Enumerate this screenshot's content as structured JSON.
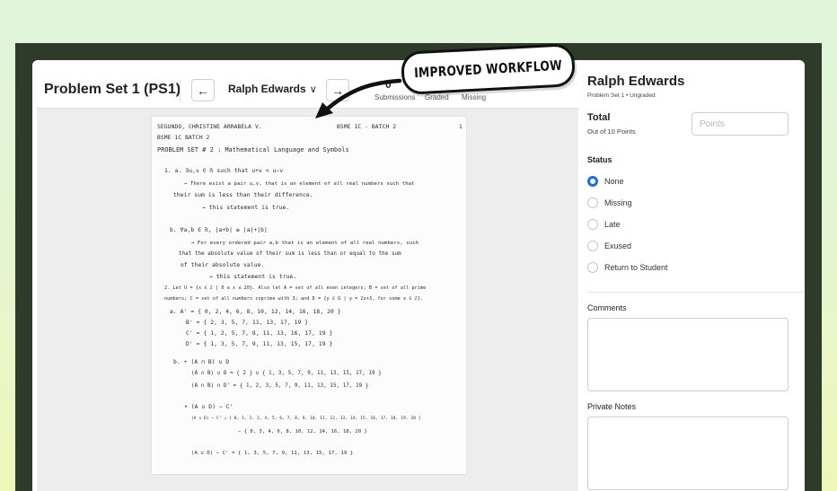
{
  "header": {
    "title": "Problem Set 1 (PS1)",
    "prev_icon": "arrow-left-icon",
    "next_icon": "arrow-right-icon",
    "student_name": "Ralph Edwards",
    "dropdown_icon": "chevron-down-icon",
    "stats": [
      {
        "value": "0",
        "label": "Submissions"
      },
      {
        "value": "",
        "label": "Graded"
      },
      {
        "value": "",
        "label": "Missing"
      }
    ]
  },
  "document": {
    "lines": [
      "SEGUNDO, CHRISTINE ARRABELA V.",
      "BSME 1C - BATCH 2",
      "1",
      "BSME 1C BATCH 2",
      "PROBLEM SET # 2 : Mathematical Language and Symbols",
      "1. a.  ∃u,v ∈ ℝ such that u+v < u−v",
      "→ There exist a pair u,v, that is an element of all real numbers such that",
      "their sum is less than their difference.",
      "→ this statement is true.",
      "b.  ∀a,b ∈ ℝ, |a+b| ≤ |a|+|b|",
      "→ For every ordered pair a,b that is an element of all real numbers, such",
      "that the absolute value of their sum is less than or equal to the sum",
      "of their absolute value.",
      "→ this statement is true.",
      "2. Let U = {x ∈ ℤ | 0 ≤ x ≤ 20}. Also let A = set of all even integers; B = set of all prime",
      "numbers; C = set of all numbers coprime with 3; and D = {y ∈ U | y = 2z+3, for some z ∈ ℤ}.",
      "a.   A' = { 0, 2, 4, 6, 8, 10, 12, 14, 16, 18, 20 }",
      "B' = { 2, 3, 5, 7, 11, 13, 17, 19 }",
      "C' = { 1, 2, 5, 7, 8, 11, 13, 16, 17, 19 }",
      "D' = { 1, 3, 5, 7, 9, 11, 13, 15, 17, 19 }",
      "b.  • (A ∩ B) ∪ D",
      "(A ∩ B) ∪ D = { 2 } ∪ { 1, 3, 5, 7, 9, 11, 13, 15, 17, 19 }",
      "(A ∩ B) ∩ D' = { 1, 2, 3, 5, 7, 9, 11, 13, 15, 17, 19 }",
      "• (A ∪ D) − C'",
      "(A ∪ D) − C' = { 0, 1, 2, 3, 4, 5, 6, 7, 8, 9, 10, 11, 12, 13, 14, 15, 16, 17, 18, 19, 20 }",
      "− { 0, 3, 4, 6, 8, 10, 12, 14, 16, 18, 20 }",
      "(A ∪ D) − C' = { 1, 3, 5, 7, 9, 11, 13, 15, 17, 19 }"
    ]
  },
  "panel": {
    "student_name": "Ralph Edwards",
    "subtitle": "Problem Set 1 • Ungraded",
    "total_label": "Total",
    "out_of": "Out of 10 Points",
    "points_placeholder": "Points",
    "status_label": "Status",
    "status_options": [
      "None",
      "Missing",
      "Late",
      "Exused",
      "Return to Student"
    ],
    "selected_status": "None",
    "comments_label": "Comments",
    "private_notes_label": "Private Notes"
  },
  "annotation": {
    "text": "IMPROVED WORKFLOW"
  },
  "colors": {
    "accent": "#1a6fe0",
    "frame": "#2e3a2a"
  }
}
